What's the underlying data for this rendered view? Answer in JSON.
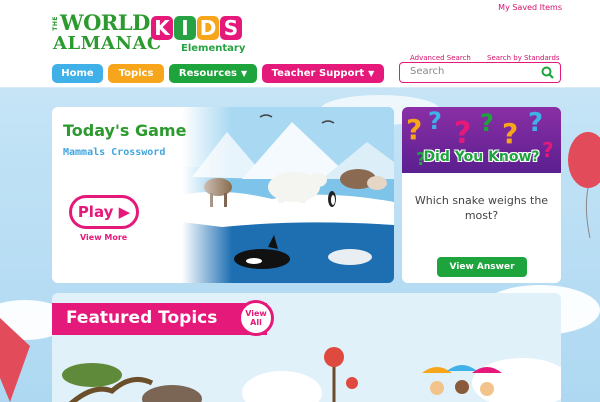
{
  "header": {
    "saved_items": "My Saved Items",
    "logo": {
      "the": "THE",
      "world": "WORLD",
      "almanac": "ALMANAC",
      "kids_letters": [
        "K",
        "I",
        "D",
        "S"
      ],
      "elementary": "Elementary"
    }
  },
  "nav": {
    "home": "Home",
    "topics": "Topics",
    "resources": "Resources",
    "teacher_support": "Teacher Support"
  },
  "search": {
    "advanced": "Advanced Search",
    "standards": "Search by Standards",
    "placeholder": "Search"
  },
  "game": {
    "title": "Today's Game",
    "subtitle": "Mammals Crossword",
    "play": "Play",
    "view_more": "View More"
  },
  "did_you_know": {
    "title": "Did You Know?",
    "question": "Which snake weighs the most?",
    "button": "View Answer"
  },
  "featured": {
    "title": "Featured Topics",
    "view_all_1": "View",
    "view_all_2": "All"
  },
  "colors": {
    "pink": "#e5197a",
    "green": "#1ea43d",
    "orange": "#f7a51b",
    "blue": "#3fb0e8",
    "purple": "#6a2a9b"
  }
}
